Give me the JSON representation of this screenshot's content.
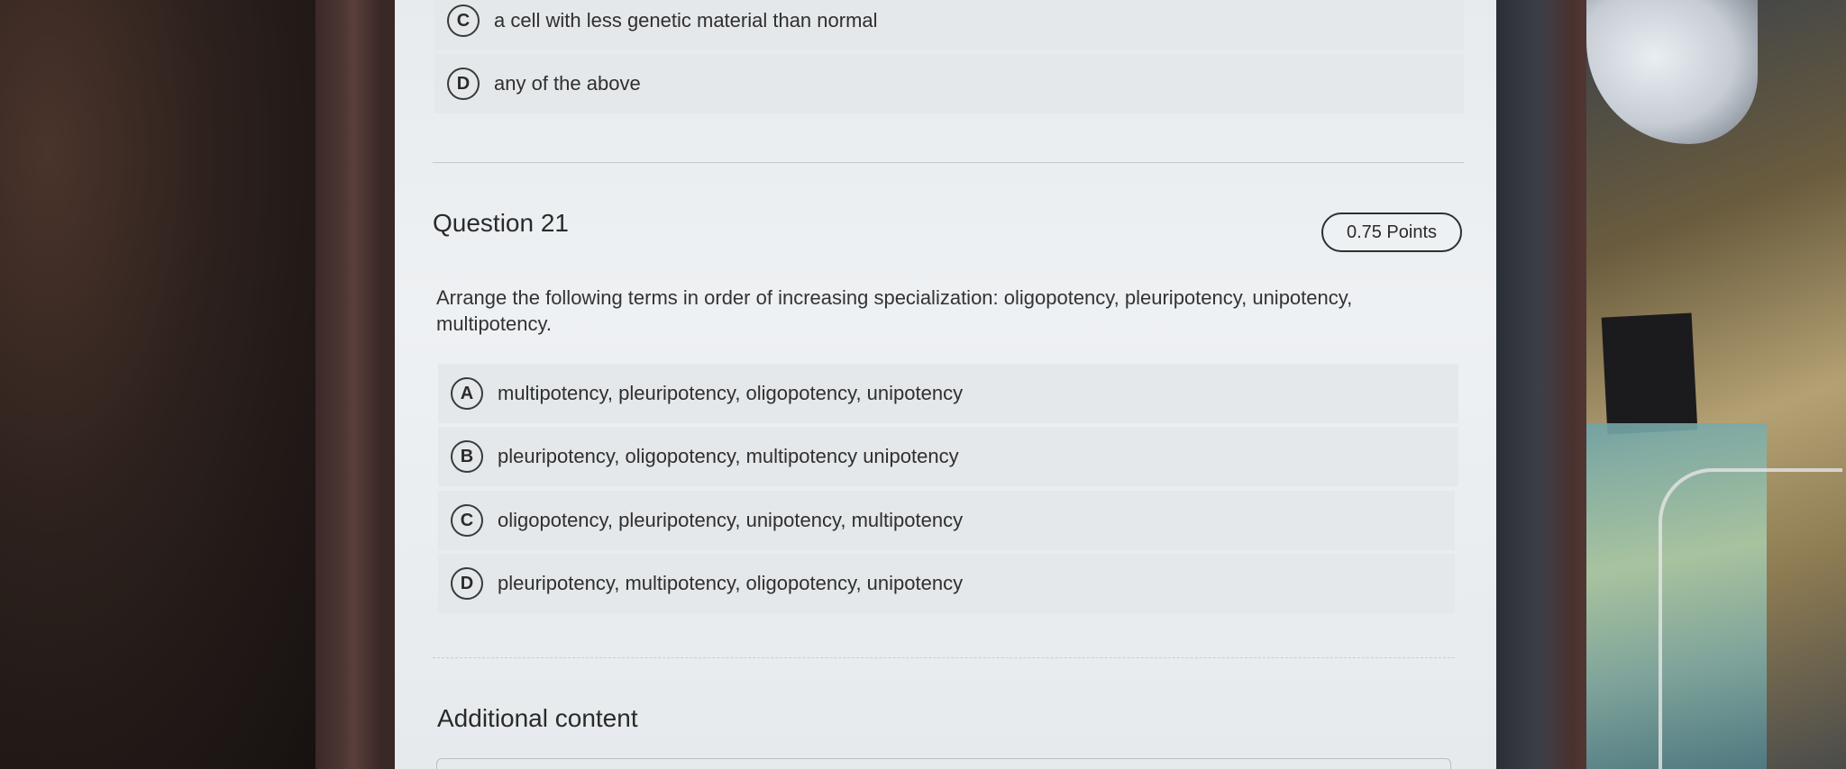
{
  "previous_question": {
    "options": [
      {
        "letter": "C",
        "text": "a cell with less genetic material than normal"
      },
      {
        "letter": "D",
        "text": "any of the above"
      }
    ]
  },
  "question": {
    "title": "Question 21",
    "points": "0.75 Points",
    "prompt": "Arrange the following terms in order of increasing specialization: oligopotency, pleuripotency, unipotency, multipotency.",
    "options": [
      {
        "letter": "A",
        "text": "multipotency, pleuripotency, oligopotency, unipotency"
      },
      {
        "letter": "B",
        "text": "pleuripotency, oligopotency, multipotency unipotency"
      },
      {
        "letter": "C",
        "text": "oligopotency, pleuripotency, unipotency, multipotency"
      },
      {
        "letter": "D",
        "text": "pleuripotency, multipotency, oligopotency, unipotency"
      }
    ]
  },
  "additional": {
    "heading": "Additional content"
  }
}
